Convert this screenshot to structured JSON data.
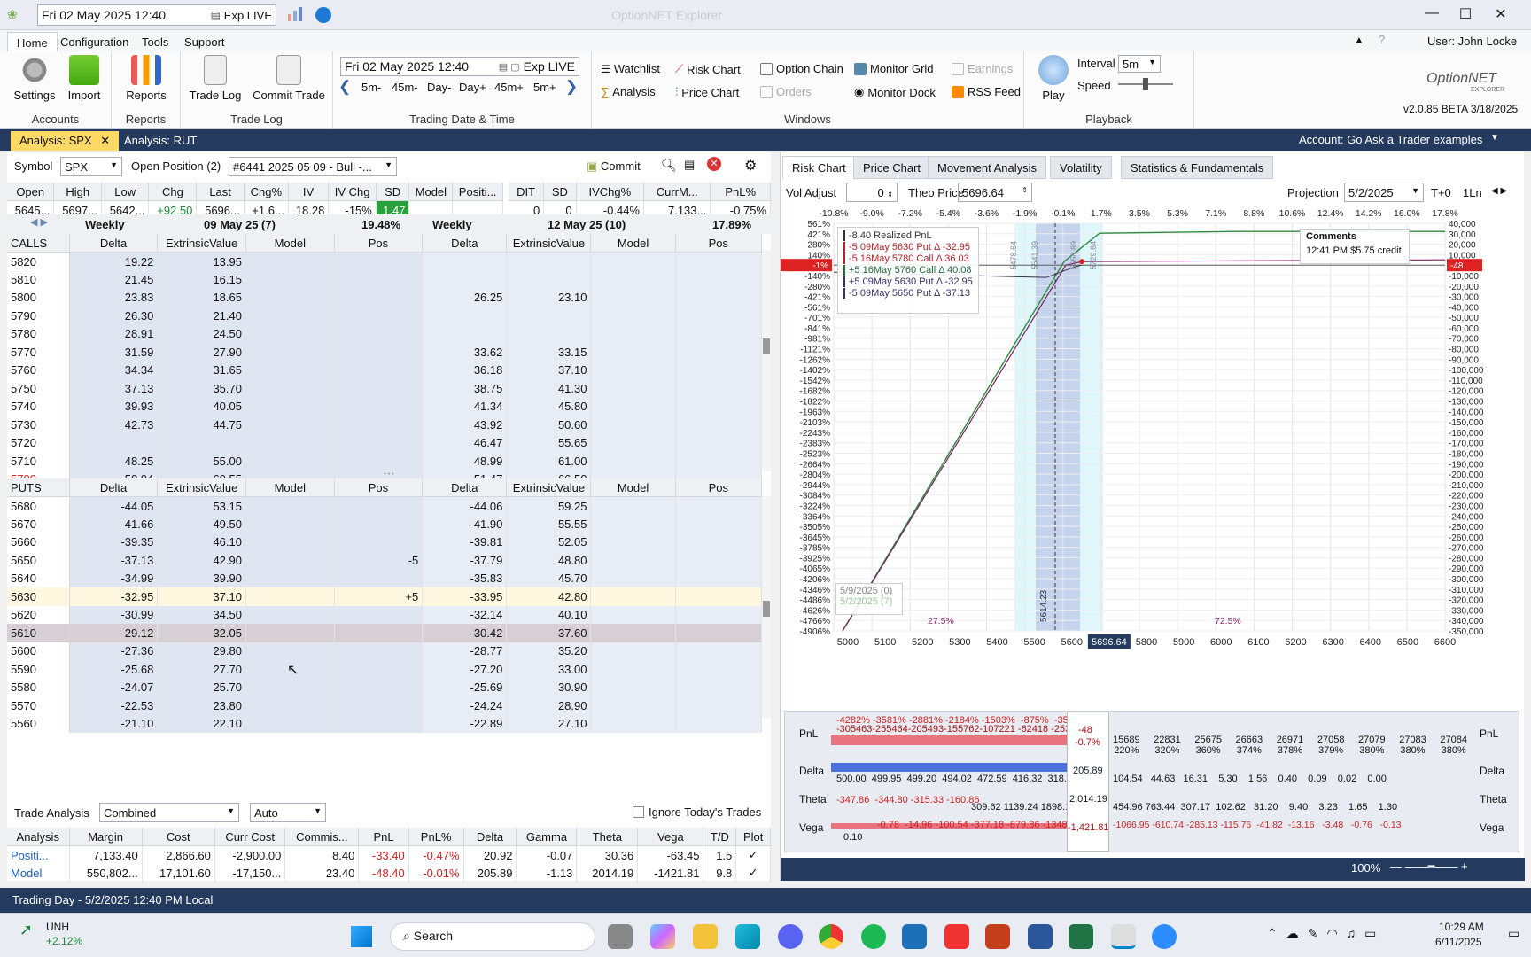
{
  "titlebar": {
    "datetime": "Fri 02 May 2025 12:40",
    "exp": "Exp LIVE",
    "title": "OptionNET Explorer"
  },
  "menu": {
    "tabs": [
      "Home",
      "Configuration",
      "Tools",
      "Support"
    ],
    "user": "User: John Locke"
  },
  "ribbon": {
    "accounts": {
      "label": "Accounts",
      "buttons": [
        "Settings",
        "Import"
      ]
    },
    "reports": {
      "label": "Reports",
      "buttons": [
        "Reports"
      ]
    },
    "tradelog": {
      "label": "Trade Log",
      "buttons": [
        "Trade Log",
        "Commit Trade"
      ]
    },
    "tdt": {
      "label": "Trading Date & Time",
      "datetime": "Fri 02 May 2025 12:40",
      "exp": "Exp LIVE",
      "steps": [
        "5m-",
        "45m-",
        "Day-",
        "Day+",
        "45m+",
        "5m+"
      ]
    },
    "windows": {
      "label": "Windows",
      "items": [
        "Watchlist",
        "Risk Chart",
        "Option Chain",
        "Monitor Grid",
        "Earnings",
        "Analysis",
        "Price Chart",
        "Orders",
        "Monitor Dock",
        "RSS Feed"
      ]
    },
    "playback": {
      "label": "Playback",
      "play": "Play",
      "interval_label": "Interval",
      "interval": "5m",
      "speed_label": "Speed"
    },
    "logo": {
      "name": "OptionNET",
      "sub": "EXPLORER",
      "version": "v2.0.85 BETA 3/18/2025"
    }
  },
  "doctabs": [
    "Analysis: SPX",
    "Analysis: RUT"
  ],
  "account": "Account: Go Ask a Trader examples",
  "symbol": {
    "label": "Symbol",
    "value": "SPX",
    "open_pos_label": "Open Position (2)",
    "position": "#6441 2025 05 09 - Bull -...",
    "commit": "Commit"
  },
  "quote": {
    "headers": [
      "Open",
      "High",
      "Low",
      "Chg",
      "Last",
      "Chg%",
      "IV",
      "IV Chg",
      "SD",
      "Model",
      "Positi..."
    ],
    "values": [
      "5645...",
      "5697...",
      "5642...",
      "+92.50",
      "5696...",
      "+1.6...",
      "18.28",
      "-15%",
      "1.47",
      "",
      ""
    ],
    "headers2": [
      "DIT",
      "SD",
      "IVChg%",
      "CurrM...",
      "PnL%"
    ],
    "values2": [
      "0",
      "0",
      "-0.44%",
      "7,133...",
      "-0.75%"
    ]
  },
  "chain": {
    "exp1": {
      "type": "Weekly",
      "date": "09 May 25 (7)",
      "iv": "19.48%"
    },
    "exp2": {
      "type": "Weekly",
      "date": "12 May 25 (10)",
      "iv": "17.89%"
    },
    "cols": [
      "Delta",
      "ExtrinsicValue",
      "Model",
      "Pos"
    ],
    "calls_label": "CALLS",
    "puts_label": "PUTS",
    "calls": [
      [
        "5820",
        "19.22",
        "13.95",
        "",
        "",
        "",
        "",
        "",
        ""
      ],
      [
        "5810",
        "21.45",
        "16.15",
        "",
        "",
        "",
        "",
        "",
        ""
      ],
      [
        "5800",
        "23.83",
        "18.65",
        "",
        "",
        "26.25",
        "23.10",
        "",
        ""
      ],
      [
        "5790",
        "26.30",
        "21.40",
        "",
        "",
        "",
        "",
        "",
        ""
      ],
      [
        "5780",
        "28.91",
        "24.50",
        "",
        "",
        "",
        "",
        "",
        ""
      ],
      [
        "5770",
        "31.59",
        "27.90",
        "",
        "",
        "33.62",
        "33.15",
        "",
        ""
      ],
      [
        "5760",
        "34.34",
        "31.65",
        "",
        "",
        "36.18",
        "37.10",
        "",
        ""
      ],
      [
        "5750",
        "37.13",
        "35.70",
        "",
        "",
        "38.75",
        "41.30",
        "",
        ""
      ],
      [
        "5740",
        "39.93",
        "40.05",
        "",
        "",
        "41.34",
        "45.80",
        "",
        ""
      ],
      [
        "5730",
        "42.73",
        "44.75",
        "",
        "",
        "43.92",
        "50.60",
        "",
        ""
      ],
      [
        "5720",
        "",
        "",
        "",
        "",
        "46.47",
        "55.65",
        "",
        ""
      ],
      [
        "5710",
        "48.25",
        "55.00",
        "",
        "",
        "48.99",
        "61.00",
        "",
        ""
      ],
      [
        "5700",
        "50.94",
        "60.55",
        "",
        "",
        "51.47",
        "66.50",
        "",
        ""
      ]
    ],
    "puts": [
      [
        "5680",
        "-44.05",
        "53.15",
        "",
        "",
        "-44.06",
        "59.25",
        "",
        ""
      ],
      [
        "5670",
        "-41.66",
        "49.50",
        "",
        "",
        "-41.90",
        "55.55",
        "",
        ""
      ],
      [
        "5660",
        "-39.35",
        "46.10",
        "",
        "",
        "-39.81",
        "52.05",
        "",
        ""
      ],
      [
        "5650",
        "-37.13",
        "42.90",
        "",
        "-5",
        "-37.79",
        "48.80",
        "",
        ""
      ],
      [
        "5640",
        "-34.99",
        "39.90",
        "",
        "",
        "-35.83",
        "45.70",
        "",
        ""
      ],
      [
        "5630",
        "-32.95",
        "37.10",
        "",
        "+5",
        "-33.95",
        "42.80",
        "",
        ""
      ],
      [
        "5620",
        "-30.99",
        "34.50",
        "",
        "",
        "-32.14",
        "40.10",
        "",
        ""
      ],
      [
        "5610",
        "-29.12",
        "32.05",
        "",
        "",
        "-30.42",
        "37.60",
        "",
        ""
      ],
      [
        "5600",
        "-27.36",
        "29.80",
        "",
        "",
        "-28.77",
        "35.20",
        "",
        ""
      ],
      [
        "5590",
        "-25.68",
        "27.70",
        "",
        "",
        "-27.20",
        "33.00",
        "",
        ""
      ],
      [
        "5580",
        "-24.07",
        "25.70",
        "",
        "",
        "-25.69",
        "30.90",
        "",
        ""
      ],
      [
        "5570",
        "-22.53",
        "23.80",
        "",
        "",
        "-24.24",
        "28.90",
        "",
        ""
      ],
      [
        "5560",
        "-21.10",
        "22.10",
        "",
        "",
        "-22.89",
        "27.10",
        "",
        ""
      ]
    ]
  },
  "trade_analysis": {
    "label": "Trade Analysis",
    "mode": "Combined",
    "auto": "Auto",
    "ignore": "Ignore Today's Trades",
    "headers": [
      "Analysis",
      "Margin",
      "Cost",
      "Curr Cost",
      "Commis...",
      "PnL",
      "PnL%",
      "Delta",
      "Gamma",
      "Theta",
      "Vega",
      "T/D",
      "Plot"
    ],
    "rows": [
      [
        "Positi...",
        "7,133.40",
        "2,866.60",
        "-2,900.00",
        "8.40",
        "-33.40",
        "-0.47%",
        "20.92",
        "-0.07",
        "30.36",
        "-63.45",
        "1.5",
        "✓"
      ],
      [
        "Model",
        "550,802...",
        "17,101.60",
        "-17,150...",
        "23.40",
        "-48.40",
        "-0.01%",
        "205.89",
        "-1.13",
        "2014.19",
        "-1421.81",
        "9.8",
        "✓"
      ]
    ]
  },
  "right": {
    "tabs": [
      "Risk Chart",
      "Price Chart",
      "Movement Analysis",
      "Volatility",
      "Statistics & Fundamentals"
    ],
    "vol_adjust_label": "Vol Adjust",
    "vol_adjust": "0",
    "theo_label": "Theo Price",
    "theo": "5696.64",
    "projection_label": "Projection",
    "projection": "5/2/2025",
    "t0": "T+0",
    "ln": "1Ln",
    "top_pct": [
      "-10.8%",
      "-9.0%",
      "-7.2%",
      "-5.4%",
      "-3.6%",
      "-1.9%",
      "-0.1%",
      "1.7%",
      "3.5%",
      "5.3%",
      "7.1%",
      "8.8%",
      "10.6%",
      "12.4%",
      "14.2%",
      "16.0%",
      "17.8%"
    ],
    "left_pct": [
      "561%",
      "421%",
      "280%",
      "140%",
      "-1%",
      "-140%",
      "-280%",
      "-421%",
      "-561%",
      "-701%",
      "-841%",
      "-981%",
      "-1121%",
      "-1262%",
      "-1402%",
      "-1542%",
      "-1682%",
      "-1822%",
      "-1963%",
      "-2103%",
      "-2243%",
      "-2383%",
      "-2523%",
      "-2664%",
      "-2804%",
      "-2944%",
      "-3084%",
      "-3224%",
      "-3364%",
      "-3505%",
      "-3645%",
      "-3785%",
      "-3925%",
      "-4065%",
      "-4206%",
      "-4346%",
      "-4486%",
      "-4626%",
      "-4766%",
      "-4906%"
    ],
    "right_vals": [
      "40,000",
      "30,000",
      "20,000",
      "10,000",
      "-48",
      "-10,000",
      "-20,000",
      "-30,000",
      "-40,000",
      "-50,000",
      "-60,000",
      "-70,000",
      "-80,000",
      "-90,000",
      "-100,000",
      "-110,000",
      "-120,000",
      "-130,000",
      "-140,000",
      "-150,000",
      "-160,000",
      "-170,000",
      "-180,000",
      "-190,000",
      "-200,000",
      "-210,000",
      "-220,000",
      "-230,000",
      "-240,000",
      "-250,000",
      "-260,000",
      "-270,000",
      "-280,000",
      "-290,000",
      "-300,000",
      "-310,000",
      "-320,000",
      "-330,000",
      "-340,000",
      "-350,000"
    ],
    "x_ticks": [
      "5000",
      "5100",
      "5200",
      "5300",
      "5400",
      "5500",
      "5600",
      "5696.64",
      "5800",
      "5900",
      "6000",
      "6100",
      "6200",
      "6300",
      "6400",
      "6500",
      "6600"
    ],
    "legend": [
      {
        "text": "-8.40 Realized PnL",
        "color": "#333"
      },
      {
        "text": "-5 09May 5630 Put Δ  -32.95",
        "color": "#b2202a"
      },
      {
        "text": "-5 16May 5780 Call Δ  36.03",
        "color": "#b2202a"
      },
      {
        "text": "+5 16May 5760 Call Δ  40.08",
        "color": "#1e6b3a"
      },
      {
        "text": "+5 09May 5630 Put Δ  -32.95",
        "color": "#333366"
      },
      {
        "text": "-5 09May 5650 Put Δ  -37.13",
        "color": "#333366"
      }
    ],
    "comments_label": "Comments",
    "comment": "12:41 PM $5.75 credit",
    "band_labels": [
      "5478.64",
      "5541.39",
      "5658.89",
      "5729.64",
      "5614.23"
    ],
    "pct_left": "27.5%",
    "pct_right": "72.5%",
    "dates": [
      "5/9/2025 (0)",
      "5/2/2025 (7)"
    ],
    "minus1": "-1%",
    "minus48": "-48",
    "zoom": "100%"
  },
  "bottomgrid": {
    "pnl_label": "PnL",
    "delta_label": "Delta",
    "theta_label": "Theta",
    "vega_label": "Vega",
    "pnl_top": "-4282% -3581% -2881% -2184% -1503%  -875%  -356%",
    "pnl_vals": "-305463-255464-205493-155762-107221 -62418 -2538",
    "pnl_right": [
      "15689",
      "22831",
      "25675",
      "26663",
      "26971",
      "27058",
      "27079",
      "27083",
      "27084"
    ],
    "pnl_right_pct": [
      "220%",
      "320%",
      "360%",
      "374%",
      "378%",
      "379%",
      "380%",
      "380%",
      "380%"
    ],
    "center_pnl": "-48",
    "center_pct": "-0.7%",
    "delta_vals": "500.00  499.95  499.20  494.02  472.59  416.32  318.4",
    "delta_center": "205.89",
    "delta_right": "104.54   44.63   16.31    5.30    1.56    0.40    0.09    0.02    0.00",
    "theta_left": "-347.86  -344.80 -315.33 -160.86",
    "theta_mid": "309.62 1139.24 1898.1",
    "theta_center": "2,014.19",
    "theta_right": "454.96 763.44  307.17  102.62   31.20    9.40    3.23    1.65    1.30",
    "vega_left": "-0.78  -14.96 -100.54 -377.18 -879.86 -1348",
    "vega_first": "0.10",
    "vega_center": "-1,421.81",
    "vega_right": "-1066.95 -610.74 -285.13 -115.76  -41.82  -13.16   -3.48   -0.76   -0.13"
  },
  "status": "Trading Day - 5/2/2025 12:40 PM Local",
  "taskbar": {
    "ticker": "UNH",
    "change": "+2.12%",
    "search": "Search",
    "time": "10:29 AM",
    "date": "6/11/2025"
  }
}
